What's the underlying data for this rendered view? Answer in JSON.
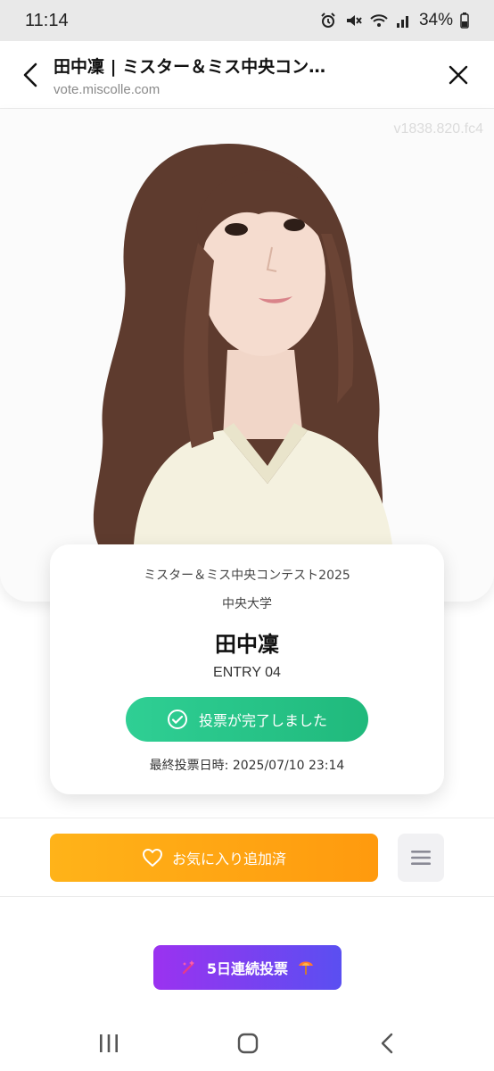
{
  "status_bar": {
    "time": "11:14",
    "battery_percent": "34%",
    "icons": [
      "alarm-icon",
      "mute-icon",
      "wifi-icon",
      "signal-icon",
      "battery-icon"
    ]
  },
  "browser": {
    "title": "田中凜 | ミスター＆ミス中央コン…",
    "url": "vote.miscolle.com",
    "back_icon": "chevron-left-icon",
    "close_icon": "close-icon"
  },
  "photo": {
    "watermark": "v1838.820.fc4"
  },
  "entry_card": {
    "contest": "ミスター＆ミス中央コンテスト2025",
    "university": "中央大学",
    "name": "田中凜",
    "entry": "ENTRY 04",
    "vote_status": "投票が完了しました",
    "last_vote": "最終投票日時: 2025/07/10 23:14"
  },
  "actions": {
    "favorite_label": "お気に入り追加済",
    "menu_icon": "menu-icon",
    "streak_label": "5日連続投票"
  },
  "colors": {
    "vote_green": "#25c285",
    "favorite_orange": "#ffa514",
    "streak_purple": "#7a40f0"
  }
}
